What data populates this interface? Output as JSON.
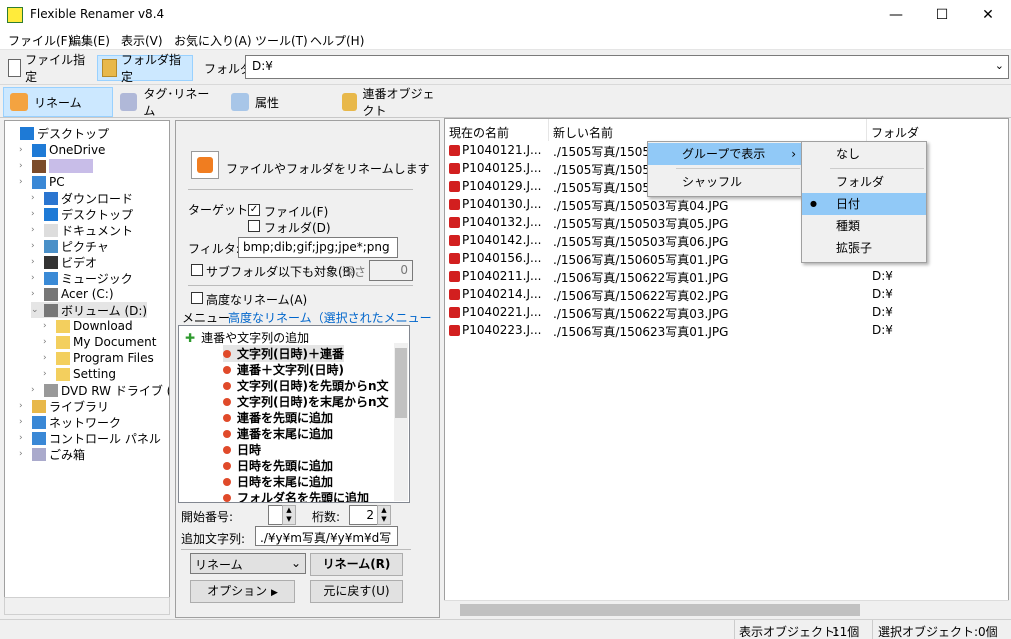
{
  "window": {
    "title": "Flexible Renamer v8.4",
    "min": "—",
    "max": "☐",
    "close": "✕"
  },
  "menu": [
    "ファイル(F)",
    "編集(E)",
    "表示(V)",
    "お気に入り(A)",
    "ツール(T)",
    "ヘルプ(H)"
  ],
  "toolbar": {
    "file_mode": "ファイル指定",
    "folder_mode": "フォルダ指定",
    "folder_label": "フォルダ",
    "folder_value": "D:¥"
  },
  "tabs": [
    "リネーム",
    "タグ･リネーム",
    "属性",
    "連番オブジェクト"
  ],
  "tree": {
    "items": [
      {
        "label": "デスクトップ",
        "level": 0,
        "icon": "desktop-icon"
      },
      {
        "label": "OneDrive",
        "level": 1,
        "icon": "cloud-icon"
      },
      {
        "label": "",
        "level": 1,
        "icon": "user-icon"
      },
      {
        "label": "PC",
        "level": 1,
        "icon": "pc-icon"
      },
      {
        "label": "ダウンロード",
        "level": 2,
        "icon": "download-icon"
      },
      {
        "label": "デスクトップ",
        "level": 2,
        "icon": "desktop-icon"
      },
      {
        "label": "ドキュメント",
        "level": 2,
        "icon": "document-icon"
      },
      {
        "label": "ピクチャ",
        "level": 2,
        "icon": "picture-icon"
      },
      {
        "label": "ビデオ",
        "level": 2,
        "icon": "video-icon"
      },
      {
        "label": "ミュージック",
        "level": 2,
        "icon": "music-icon"
      },
      {
        "label": "Acer (C:)",
        "level": 2,
        "icon": "drive-icon"
      },
      {
        "label": "ボリューム (D:)",
        "level": 2,
        "icon": "drive-icon"
      },
      {
        "label": "Download",
        "level": 3,
        "icon": "folder-icon"
      },
      {
        "label": "My Document",
        "level": 3,
        "icon": "folder-icon"
      },
      {
        "label": "Program Files",
        "level": 3,
        "icon": "folder-icon"
      },
      {
        "label": "Setting",
        "level": 3,
        "icon": "folder-icon"
      },
      {
        "label": "DVD RW ドライブ (E:)",
        "level": 2,
        "icon": "dvd-icon"
      },
      {
        "label": "ライブラリ",
        "level": 1,
        "icon": "library-icon"
      },
      {
        "label": "ネットワーク",
        "level": 1,
        "icon": "network-icon"
      },
      {
        "label": "コントロール パネル",
        "level": 1,
        "icon": "control-panel-icon"
      },
      {
        "label": "ごみ箱",
        "level": 1,
        "icon": "recycle-bin-icon"
      }
    ]
  },
  "rename_panel": {
    "heading": "ファイルやフォルダをリネームします",
    "target_label": "ターゲット:",
    "target_file": "ファイル(F)",
    "target_folder": "フォルダ(D)",
    "filter_label": "フィルタ:",
    "filter_value": "bmp;dib;gif;jpg;jpe*;png",
    "subfolder_label": "サブフォルダ以下も対象(B)",
    "depth_label": "深さ",
    "depth_value": "0",
    "advanced_label": "高度なリネーム(A)",
    "menu_label": "メニュー",
    "menu_link": "高度なリネーム（選択されたメニュー項目）",
    "menu_root": "連番や文字列の追加",
    "menu_items": [
      "文字列(日時)＋連番",
      "連番＋文字列(日時)",
      "文字列(日時)を先頭からn文",
      "文字列(日時)を末尾からn文",
      "連番を先頭に追加",
      "連番を末尾に追加",
      "日時",
      "日時を先頭に追加",
      "日時を末尾に追加",
      "フォルダ名を先頭に追加"
    ],
    "start_label": "開始番号:",
    "start_value": "1",
    "digits_label": "桁数:",
    "digits_value": "2",
    "append_label": "追加文字列:",
    "append_value": "./¥y¥m写真/¥y¥m¥d写",
    "mode_value": "リネーム",
    "rename_button": "リネーム(R)",
    "options_button": "オプション",
    "undo_button": "元に戻す(U)"
  },
  "list": {
    "columns": [
      "現在の名前",
      "新しい名前",
      "フォルダ"
    ],
    "rows": [
      {
        "cur": "P1040121.J...",
        "new": "./1505写真/1505",
        "folder": ""
      },
      {
        "cur": "P1040125.J...",
        "new": "./1505写真/1505",
        "folder": ""
      },
      {
        "cur": "P1040129.J...",
        "new": "./1505写真/1505",
        "folder": ""
      },
      {
        "cur": "P1040130.J...",
        "new": "./1505写真/150503写真04.JPG",
        "folder": ""
      },
      {
        "cur": "P1040132.J...",
        "new": "./1505写真/150503写真05.JPG",
        "folder": ""
      },
      {
        "cur": "P1040142.J...",
        "new": "./1505写真/150503写真06.JPG",
        "folder": ""
      },
      {
        "cur": "P1040156.J...",
        "new": "./1506写真/150605写真01.JPG",
        "folder": "D:¥"
      },
      {
        "cur": "P1040211.J...",
        "new": "./1506写真/150622写真01.JPG",
        "folder": "D:¥"
      },
      {
        "cur": "P1040214.J...",
        "new": "./1506写真/150622写真02.JPG",
        "folder": "D:¥"
      },
      {
        "cur": "P1040221.J...",
        "new": "./1506写真/150622写真03.JPG",
        "folder": "D:¥"
      },
      {
        "cur": "P1040223.J...",
        "new": "./1506写真/150623写真01.JPG",
        "folder": "D:¥"
      }
    ]
  },
  "context_menu": {
    "items": [
      "グループで表示",
      "シャッフル"
    ],
    "submenu": [
      "なし",
      "フォルダ",
      "日付",
      "種類",
      "拡張子"
    ],
    "selected": "日付"
  },
  "status": {
    "display_label": "表示オブジェクト:",
    "display_count": "11個",
    "select_label": "選択オブジェクト:",
    "select_count": "0個"
  }
}
